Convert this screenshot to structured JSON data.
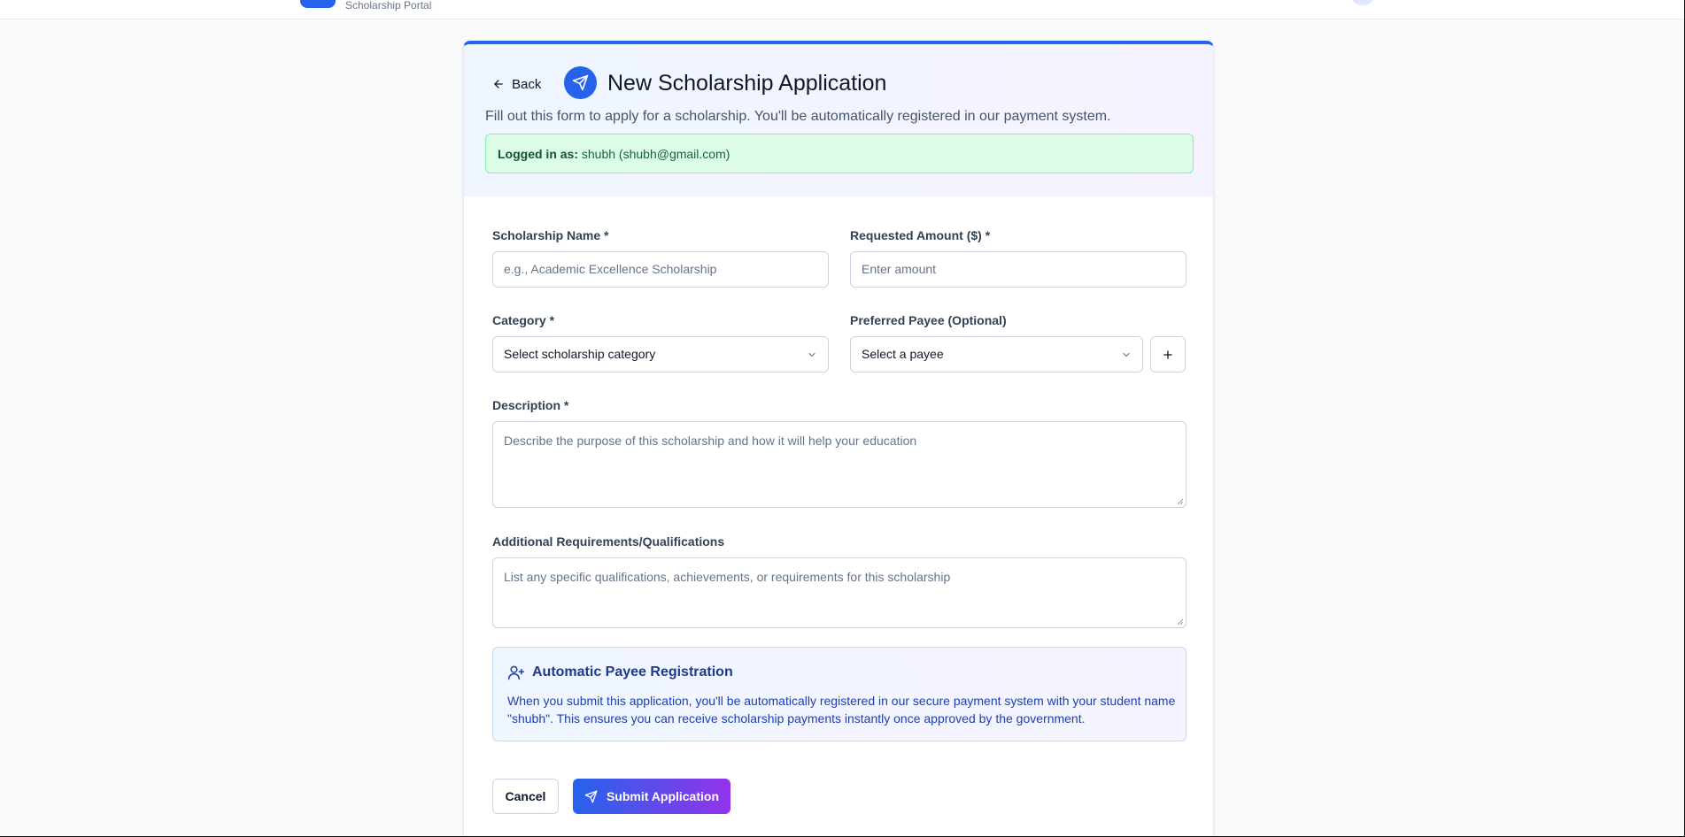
{
  "topbar": {
    "portal_subtitle": "Scholarship Portal"
  },
  "header": {
    "back_label": "Back",
    "title": "New Scholarship Application",
    "subtitle": "Fill out this form to apply for a scholarship. You'll be automatically registered in our payment system.",
    "login_label": "Logged in as:",
    "login_value": "shubh (shubh@gmail.com)"
  },
  "form": {
    "scholarship_name": {
      "label": "Scholarship Name *",
      "placeholder": "e.g., Academic Excellence Scholarship",
      "value": ""
    },
    "requested_amount": {
      "label": "Requested Amount ($) *",
      "placeholder": "Enter amount",
      "value": ""
    },
    "category": {
      "label": "Category *",
      "selected": "Select scholarship category"
    },
    "preferred_payee": {
      "label": "Preferred Payee (Optional)",
      "selected": "Select a payee"
    },
    "description": {
      "label": "Description *",
      "placeholder": "Describe the purpose of this scholarship and how it will help your education"
    },
    "requirements": {
      "label": "Additional Requirements/Qualifications",
      "placeholder": "List any specific qualifications, achievements, or requirements for this scholarship"
    }
  },
  "info": {
    "title": "Automatic Payee Registration",
    "text": "When you submit this application, you'll be automatically registered in our secure payment system with your student name \"shubh\". This ensures you can receive scholarship payments instantly once approved by the government."
  },
  "actions": {
    "cancel_label": "Cancel",
    "submit_label": "Submit Application"
  },
  "icons": {
    "back": "arrow-left-icon",
    "title": "send-icon",
    "chevron": "chevron-down-icon",
    "add": "plus-icon",
    "info": "user-plus-icon",
    "submit": "send-icon"
  },
  "colors": {
    "accent": "#2563eb",
    "accent_secondary": "#9333ea",
    "success_bg": "#dcfce7",
    "info_text": "#1e40af"
  }
}
